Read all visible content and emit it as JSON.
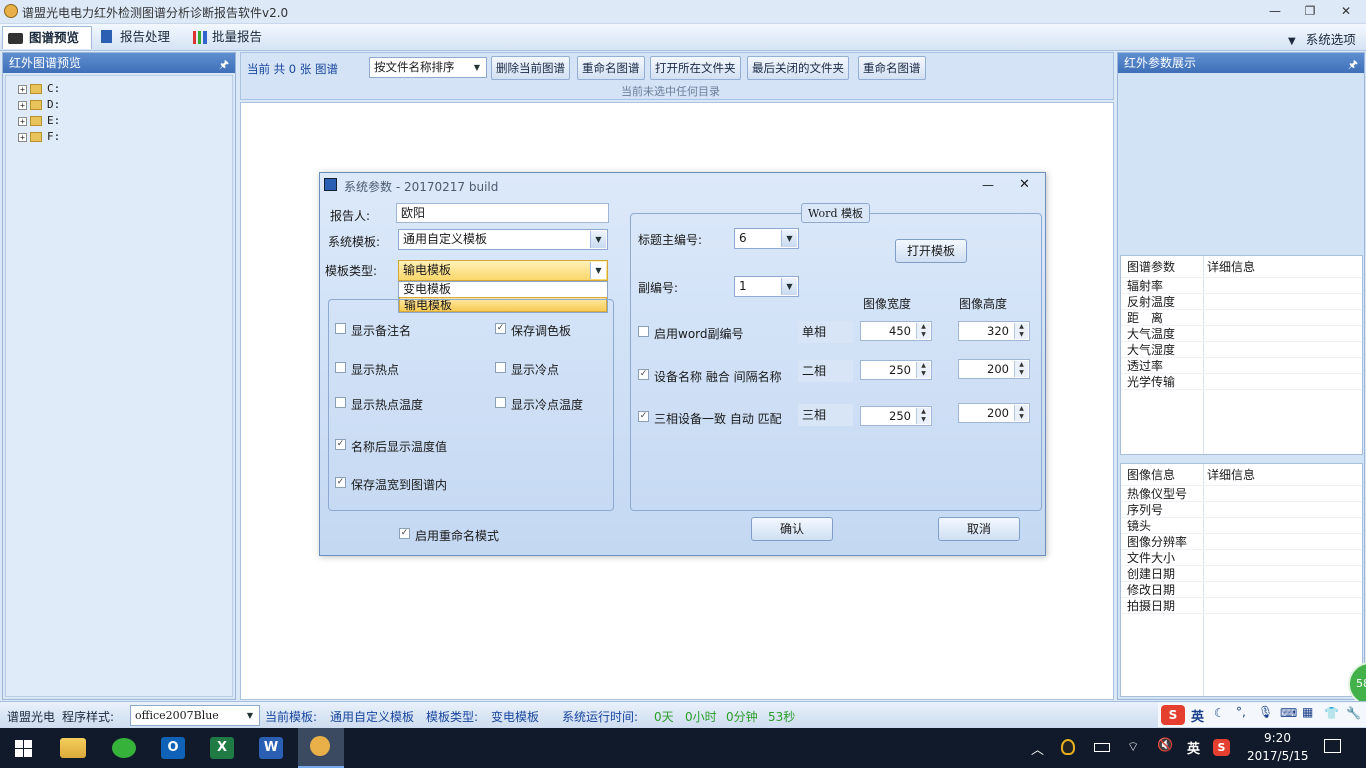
{
  "app": {
    "title": "谱盟光电电力红外检测图谱分析诊断报告软件v2.0"
  },
  "menu": {
    "tabs": [
      {
        "label": "图谱预览",
        "active": true
      },
      {
        "label": "报告处理"
      },
      {
        "label": "批量报告"
      }
    ],
    "system_options": "系统选项"
  },
  "left_panel": {
    "title": "红外图谱预览",
    "drives": [
      "C:",
      "D:",
      "E:",
      "F:"
    ]
  },
  "toolbar": {
    "count_text": "当前 共 0 张 图谱",
    "sort_value": "按文件名称排序",
    "buttons": [
      "删除当前图谱",
      "重命名图谱",
      "打开所在文件夹",
      "最后关闭的文件夹",
      "重命名图谱"
    ],
    "status": "当前未选中任何目录"
  },
  "right_panel": {
    "title": "红外参数展示",
    "spectrum_grid": {
      "col1": "图谱参数",
      "col2": "详细信息",
      "rows": [
        "辐射率",
        "反射温度",
        "距　离",
        "大气温度",
        "大气湿度",
        "透过率",
        "光学传输"
      ]
    },
    "image_grid": {
      "col1": "图像信息",
      "col2": "详细信息",
      "rows": [
        "热像仪型号",
        "序列号",
        "镜头",
        "图像分辨率",
        "文件大小",
        "创建日期",
        "修改日期",
        "拍摄日期"
      ]
    }
  },
  "dialog": {
    "title": "系统参数 - 20170217 build",
    "reporter_label": "报告人:",
    "reporter_value": "欧阳",
    "template_label": "系统模板:",
    "template_value": "通用自定义模板",
    "type_label": "模板类型:",
    "type_value": "输电模板",
    "type_options": [
      "变电模板",
      "输电模板"
    ],
    "checks": [
      {
        "label": "显示备注名",
        "checked": false
      },
      {
        "label": "保存调色板",
        "checked": true
      },
      {
        "label": "显示热点",
        "checked": false
      },
      {
        "label": "显示冷点",
        "checked": false
      },
      {
        "label": "显示热点温度",
        "checked": false
      },
      {
        "label": "显示冷点温度",
        "checked": false
      },
      {
        "label": "名称后显示温度值",
        "checked": true
      },
      {
        "label": "保存温宽到图谱内",
        "checked": true
      }
    ],
    "rename_mode": {
      "label": "启用重命名模式",
      "checked": true
    },
    "word_group": {
      "title": "Word 模板",
      "main_no_label": "标题主编号:",
      "main_no_value": "6",
      "open_button": "打开模板",
      "sub_no_label": "副编号:",
      "sub_no_value": "1",
      "col_width": "图像宽度",
      "col_height": "图像高度",
      "rows": [
        {
          "check_label": "启用word副编号",
          "checked": false,
          "phase": "单相",
          "width": "450",
          "height": "320"
        },
        {
          "check_label": "设备名称 融合 间隔名称",
          "checked": true,
          "phase": "二相",
          "width": "250",
          "height": "200"
        },
        {
          "check_label": "三相设备一致 自动 匹配",
          "checked": true,
          "phase": "三相",
          "width": "250",
          "height": "200"
        }
      ]
    },
    "confirm": "确认",
    "cancel": "取消"
  },
  "statusbar": {
    "brand": "谱盟光电",
    "style_label": "程序样式:",
    "style_value": "office2007Blue",
    "template_label": "当前模板:",
    "template_value": "通用自定义模板",
    "type_label": "模板类型:",
    "type_value": "变电模板",
    "runtime_label": "系统运行时间:",
    "days": "0天",
    "hours": "0小时",
    "minutes": "0分钟",
    "seconds": "53秒"
  },
  "badge": "58",
  "ime": {
    "lang": "英"
  },
  "taskbar": {
    "time": "9:20",
    "date": "2017/5/15",
    "lang": "英"
  }
}
